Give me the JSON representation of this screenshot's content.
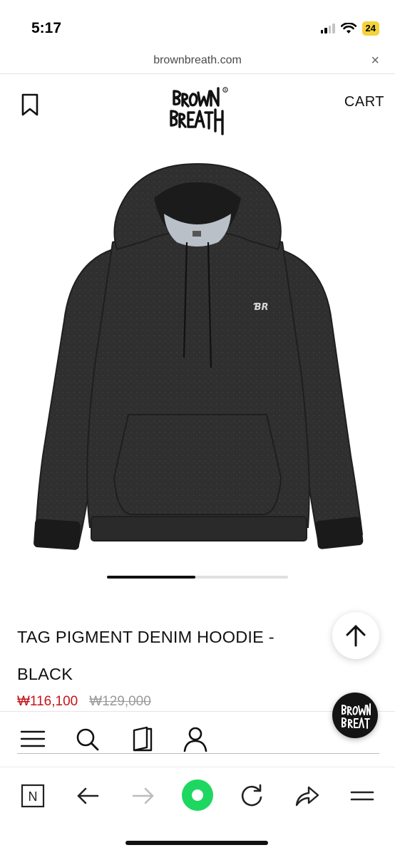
{
  "status_bar": {
    "time": "5:17",
    "battery": "24",
    "icons": [
      "cellular-signal-icon",
      "wifi-icon",
      "battery-icon"
    ]
  },
  "url_bar": {
    "domain": "brownbreath.com",
    "close_label": "×"
  },
  "header": {
    "logo_text": "BROWN BREATH",
    "cart_label": "CART",
    "bookmark_icon": "bookmark-icon"
  },
  "product": {
    "title": "TAG PIGMENT DENIM HOODIE - BLACK",
    "sale_price": "₩116,100",
    "original_price": "₩129,000",
    "image_alt": "black pigment denim hoodie",
    "carousel_progress": 0.49
  },
  "site_nav": {
    "items": [
      "menu-icon",
      "search-icon",
      "book-icon",
      "user-icon"
    ]
  },
  "browser_toolbar": {
    "items": [
      "naver-n-icon",
      "back-arrow-icon",
      "forward-arrow-icon",
      "green-home-icon",
      "refresh-icon",
      "share-icon",
      "menu-lines-icon"
    ],
    "n_label": "N"
  },
  "colors": {
    "sale_price": "#c4161c",
    "original_price": "#9a9a9a",
    "green_button": "#1ed760",
    "battery_badge": "#f4d33b"
  }
}
